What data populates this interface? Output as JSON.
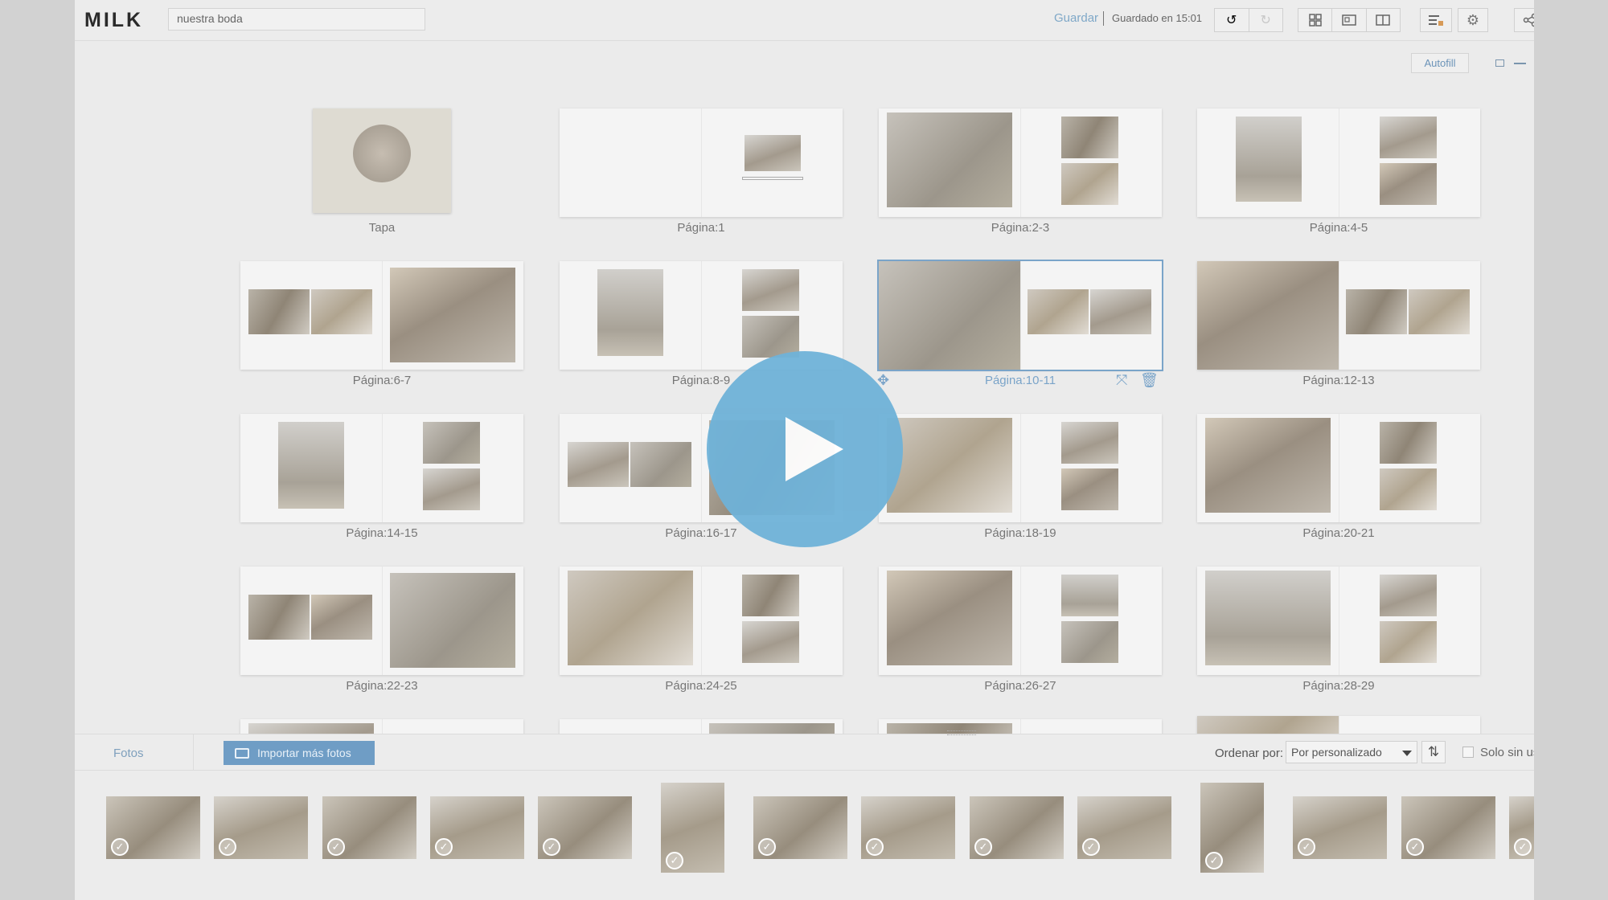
{
  "header": {
    "logo": "MILK",
    "album_title": "nuestra boda",
    "save_label": "Guardar",
    "saved_status": "Guardado en 15:01",
    "icons": [
      "undo-icon",
      "redo-icon",
      "grid-view-icon",
      "spread-view-icon",
      "page-view-icon",
      "list-settings-icon",
      "gear-icon",
      "share-icon"
    ]
  },
  "editor": {
    "autofill_label": "Autofill"
  },
  "pages": [
    {
      "label": "Tapa"
    },
    {
      "label": "Página:1"
    },
    {
      "label": "Página:2-3"
    },
    {
      "label": "Página:4-5"
    },
    {
      "label": "Página:6-7"
    },
    {
      "label": "Página:8-9"
    },
    {
      "label": "Página:10-11",
      "selected": true
    },
    {
      "label": "Página:12-13"
    },
    {
      "label": "Página:14-15"
    },
    {
      "label": "Página:16-17"
    },
    {
      "label": "Página:18-19"
    },
    {
      "label": "Página:20-21"
    },
    {
      "label": "Página:22-23"
    },
    {
      "label": "Página:24-25"
    },
    {
      "label": "Página:26-27"
    },
    {
      "label": "Página:28-29"
    }
  ],
  "photos_panel": {
    "tab_label": "Fotos",
    "import_label": "Importar más fotos",
    "sort_label": "Ordenar por:",
    "sort_value": "Por personalizado",
    "only_unused_label": "Solo sin us",
    "thumb_count": 14
  },
  "colors": {
    "accent": "#7aa4c9",
    "play_button": "#6fb2d8",
    "import_button": "#6f9dc5"
  }
}
